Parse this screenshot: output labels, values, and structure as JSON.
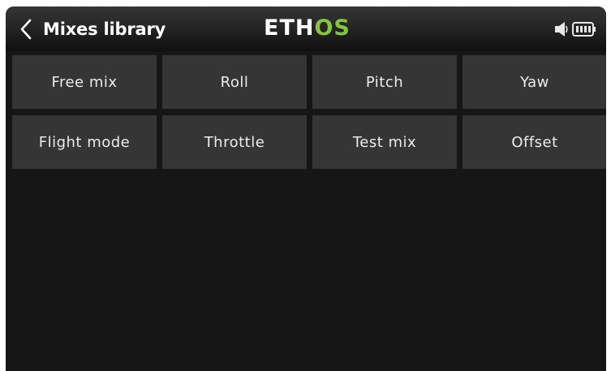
{
  "header": {
    "title": "Mixes library",
    "logo_left": "ETH",
    "logo_right": "OS",
    "back_icon": "chevron-left-icon",
    "status_icons": [
      "speaker-icon",
      "battery-icon"
    ]
  },
  "colors": {
    "background": "#161616",
    "tile": "#353535",
    "text": "#ececec",
    "logo_accent": "#86c440"
  },
  "mixes": [
    {
      "label": "Free mix"
    },
    {
      "label": "Roll"
    },
    {
      "label": "Pitch"
    },
    {
      "label": "Yaw"
    },
    {
      "label": "Flight mode"
    },
    {
      "label": "Throttle"
    },
    {
      "label": "Test mix"
    },
    {
      "label": "Offset"
    }
  ]
}
